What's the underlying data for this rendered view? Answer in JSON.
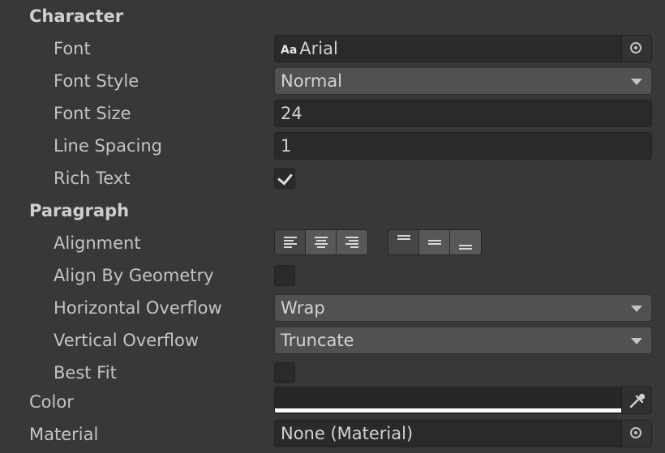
{
  "character": {
    "heading": "Character",
    "font": {
      "label": "Font",
      "prefix": "Aa",
      "value": "Arial",
      "icon": "object-picker-icon"
    },
    "font_style": {
      "label": "Font Style",
      "value": "Normal",
      "icon": "dropdown-caret-icon"
    },
    "font_size": {
      "label": "Font Size",
      "value": "24"
    },
    "line_spacing": {
      "label": "Line Spacing",
      "value": "1"
    },
    "rich_text": {
      "label": "Rich Text",
      "checked": true
    }
  },
  "paragraph": {
    "heading": "Paragraph",
    "alignment": {
      "label": "Alignment",
      "horizontal": [
        {
          "name": "align-left-icon",
          "active": true
        },
        {
          "name": "align-center-icon",
          "active": false
        },
        {
          "name": "align-right-icon",
          "active": false
        }
      ],
      "vertical": [
        {
          "name": "align-top-icon",
          "active": true
        },
        {
          "name": "align-middle-icon",
          "active": false
        },
        {
          "name": "align-bottom-icon",
          "active": false
        }
      ]
    },
    "align_by_geometry": {
      "label": "Align By Geometry",
      "checked": false
    },
    "horizontal_overflow": {
      "label": "Horizontal Overflow",
      "value": "Wrap"
    },
    "vertical_overflow": {
      "label": "Vertical Overflow",
      "value": "Truncate"
    },
    "best_fit": {
      "label": "Best Fit",
      "checked": false
    }
  },
  "color": {
    "label": "Color",
    "swatch": "#272727",
    "alpha_bar": "#ffffff",
    "icon": "eyedropper-icon"
  },
  "material": {
    "label": "Material",
    "value": "None (Material)",
    "icon": "object-picker-icon"
  },
  "theme": {
    "background": "#383838",
    "text": "#c4c4c4",
    "field": "#2a2a2a",
    "dropdown": "#515151"
  }
}
